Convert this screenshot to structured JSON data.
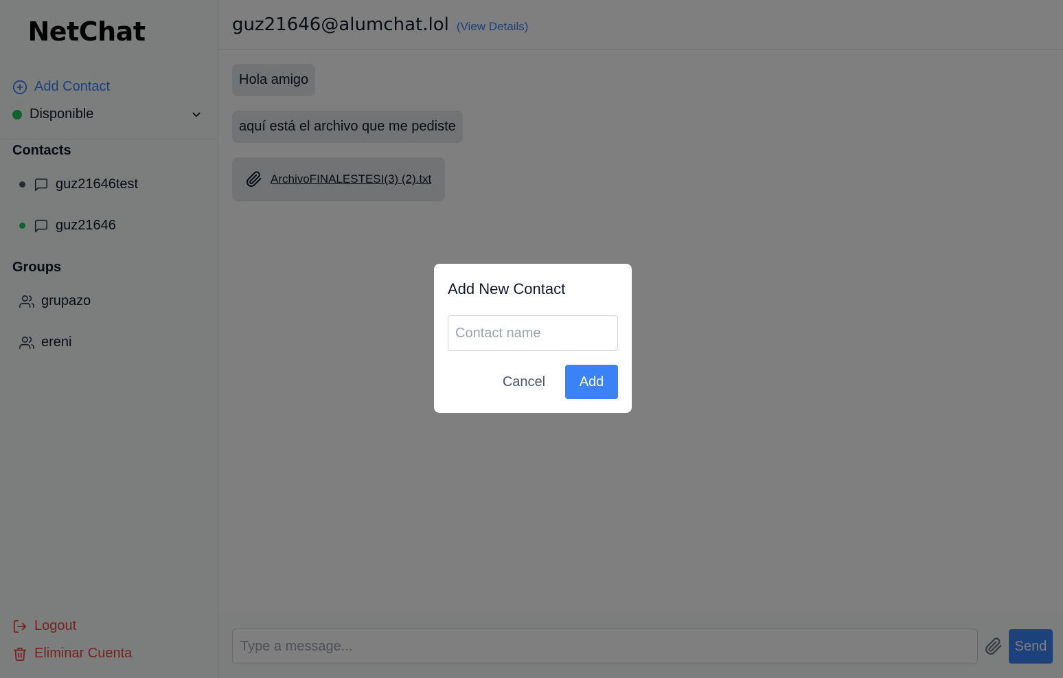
{
  "app": {
    "title": "NetChat"
  },
  "sidebar": {
    "add_contact_label": "Add Contact",
    "status": {
      "label": "Disponible",
      "color": "#22c55e"
    },
    "contacts_title": "Contacts",
    "contacts": [
      {
        "name": "guz21646test",
        "presence_color": "#4b5563",
        "icon": "message-square-icon"
      },
      {
        "name": "guz21646",
        "presence_color": "#22c55e",
        "icon": "message-square-icon"
      }
    ],
    "groups_title": "Groups",
    "groups": [
      {
        "name": "grupazo",
        "icon": "users-icon"
      },
      {
        "name": "ereni",
        "icon": "users-icon"
      }
    ],
    "logout_label": "Logout",
    "delete_account_label": "Eliminar Cuenta"
  },
  "chat": {
    "title": "guz21646@alumchat.lol",
    "view_details_label": "(View Details)",
    "messages": [
      {
        "type": "text",
        "text": "Hola amigo"
      },
      {
        "type": "text",
        "text": "aquí está el archivo que me pediste"
      },
      {
        "type": "file",
        "file_name": "ArchivoFINALESTESI(3) (2).txt",
        "icon": "paperclip-icon"
      }
    ],
    "composer": {
      "placeholder": "Type a message...",
      "send_label": "Send",
      "attach_icon": "paperclip-icon"
    }
  },
  "modal": {
    "title": "Add New Contact",
    "input_placeholder": "Contact name",
    "cancel_label": "Cancel",
    "add_label": "Add"
  },
  "colors": {
    "accent": "#3b82f6",
    "danger": "#ef4444",
    "online": "#22c55e",
    "overlay": "rgba(0,0,0,0.5)"
  }
}
